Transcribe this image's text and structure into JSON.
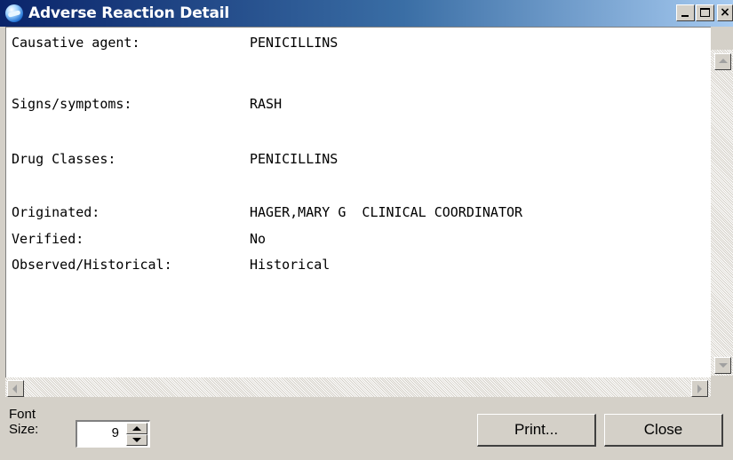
{
  "window": {
    "title": "Adverse Reaction Detail",
    "icon": "app-globe-icon",
    "controls": {
      "minimize": "minimize-icon",
      "maximize": "maximize-icon",
      "close_glyph": "×"
    }
  },
  "detail": {
    "rows": [
      {
        "label": "Causative agent:",
        "value": "PENICILLINS"
      },
      {
        "label": "Signs/symptoms:",
        "value": "RASH"
      },
      {
        "label": "Drug Classes:",
        "value": "PENICILLINS"
      },
      {
        "label": "Originated:",
        "value": "HAGER,MARY G  CLINICAL COORDINATOR"
      },
      {
        "label": "Verified:",
        "value": "No"
      },
      {
        "label": "Observed/Historical:",
        "value": "Historical"
      }
    ]
  },
  "footer": {
    "font_label_line1": "Font",
    "font_label_line2": "Size:",
    "font_size": "9",
    "print_label": "Print...",
    "close_label": "Close"
  }
}
